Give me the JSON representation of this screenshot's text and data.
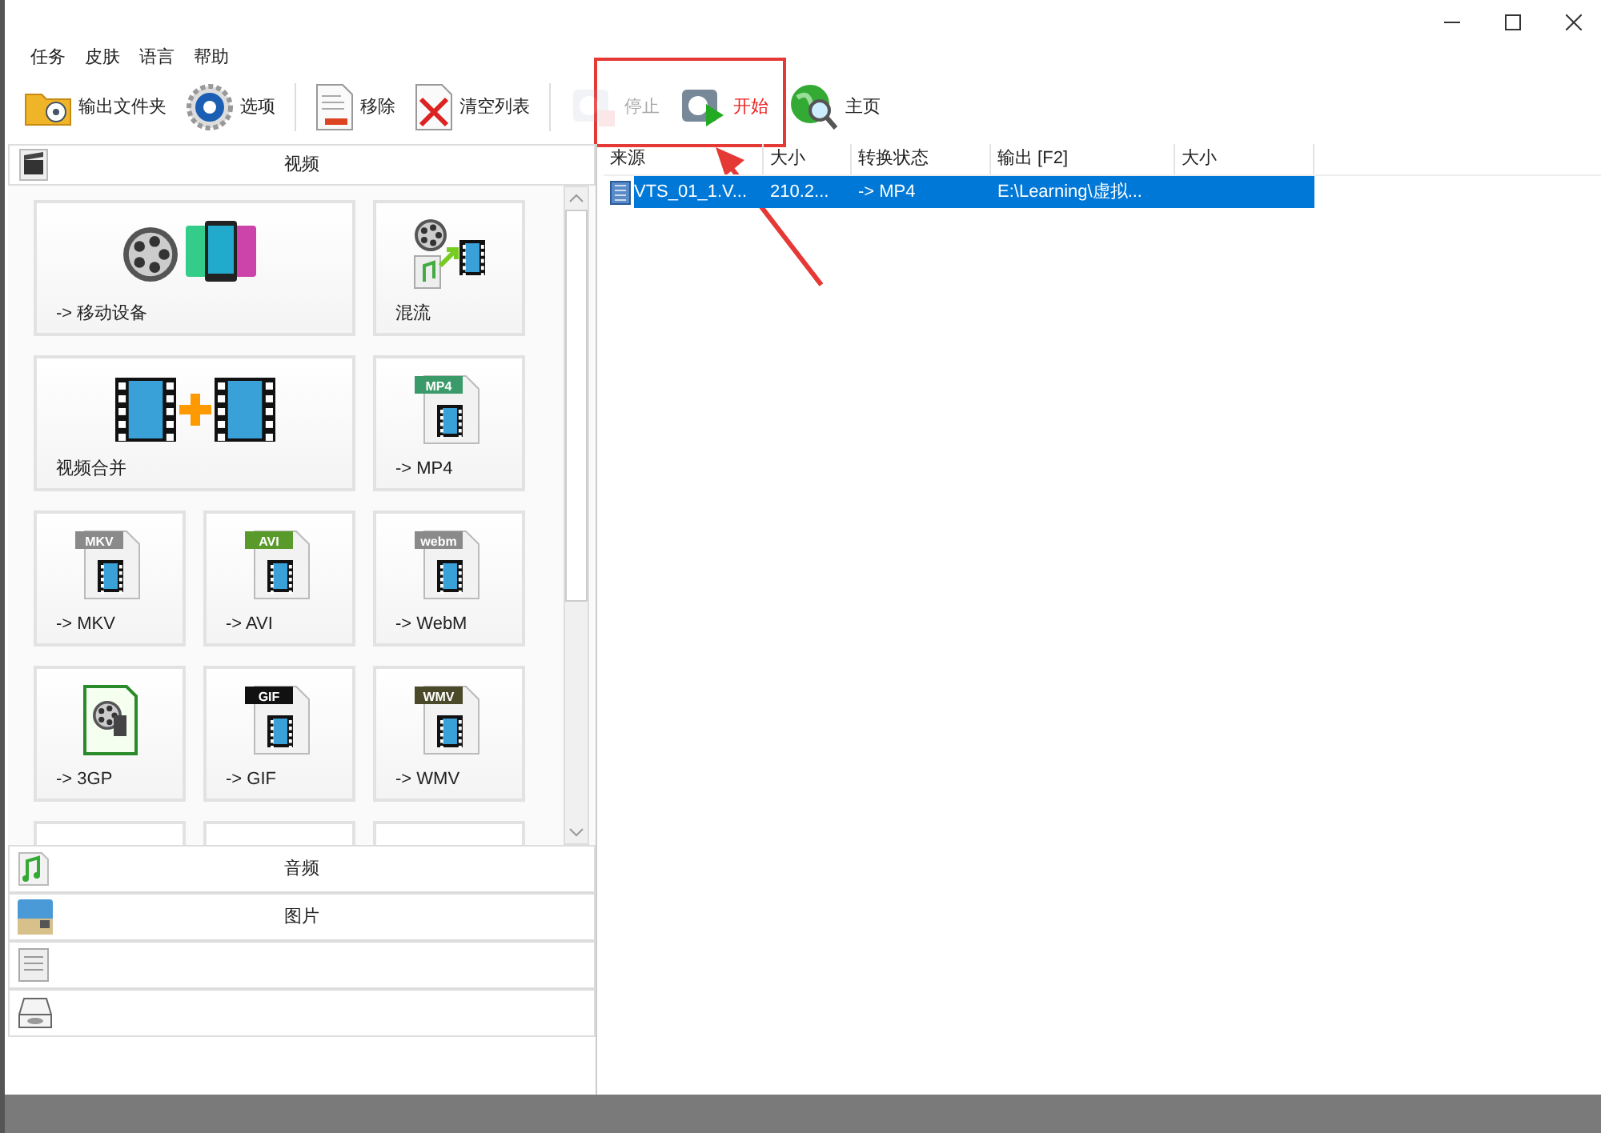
{
  "menu": [
    "任务",
    "皮肤",
    "语言",
    "帮助"
  ],
  "toolbar": [
    {
      "kind": "folder",
      "label": "输出文件夹",
      "disabled": false,
      "highlighted": false
    },
    {
      "kind": "gear",
      "label": "选项",
      "disabled": false,
      "highlighted": false
    },
    {
      "kind": "separator"
    },
    {
      "kind": "remove",
      "label": "移除",
      "disabled": false,
      "highlighted": false
    },
    {
      "kind": "clear",
      "label": "清空列表",
      "disabled": false,
      "highlighted": false
    },
    {
      "kind": "separator"
    },
    {
      "kind": "stop",
      "label": "停止",
      "disabled": true,
      "highlighted": false
    },
    {
      "kind": "start",
      "label": "开始",
      "disabled": false,
      "highlighted": true
    },
    {
      "kind": "home",
      "label": "主页",
      "disabled": false,
      "highlighted": false
    }
  ],
  "panel": {
    "header": "视频",
    "tiles": [
      {
        "kind": "mobile",
        "label": "-> 移动设备",
        "wide": true
      },
      {
        "kind": "mux",
        "label": "混流",
        "wide": false
      },
      {
        "kind": "merge",
        "label": "视频合并",
        "wide": true
      },
      {
        "kind": "file",
        "badge": "MP4",
        "color": "#3a9a6a",
        "label": "-> MP4",
        "wide": false
      },
      {
        "kind": "file",
        "badge": "MKV",
        "color": "#8a8a8a",
        "label": "-> MKV",
        "wide": false
      },
      {
        "kind": "file",
        "badge": "AVI",
        "color": "#5a9a2a",
        "label": "-> AVI",
        "wide": false
      },
      {
        "kind": "file",
        "badge": "webm",
        "color": "#8a8a8b",
        "label": "-> WebM",
        "wide": false
      },
      {
        "kind": "file3gp",
        "label": "-> 3GP",
        "wide": false
      },
      {
        "kind": "file",
        "badge": "GIF",
        "color": "#111111",
        "label": "-> GIF",
        "wide": false
      },
      {
        "kind": "file",
        "badge": "WMV",
        "color": "#4a4a2a",
        "label": "-> WMV",
        "wide": false
      },
      {
        "kind": "blank",
        "wide": false
      },
      {
        "kind": "blank",
        "wide": false
      },
      {
        "kind": "blank",
        "wide": false
      }
    ],
    "categories": [
      {
        "kind": "music",
        "label": "音频"
      },
      {
        "kind": "photo",
        "label": "图片"
      },
      {
        "kind": "document"
      },
      {
        "kind": "drive"
      }
    ]
  },
  "table": {
    "columns": [
      "来源",
      "大小",
      "转换状态",
      "输出 [F2]",
      "大小"
    ],
    "rows": [
      {
        "selected": true,
        "cells": [
          "VTS_01_1.V...",
          "210.2...",
          "-> MP4",
          "E:\\Learning\\虚拟...",
          ""
        ]
      }
    ]
  }
}
